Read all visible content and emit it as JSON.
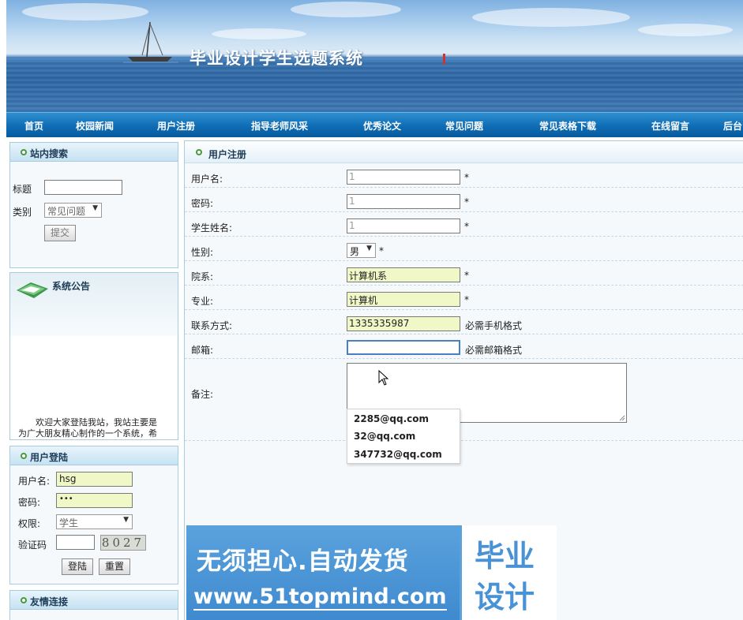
{
  "banner": {
    "title": "毕业设计学生选题系统"
  },
  "nav": {
    "items": [
      "首页",
      "校园新闻",
      "用户注册",
      "指导老师风采",
      "优秀论文",
      "常见问题",
      "常见表格下载",
      "在线留言",
      "后台"
    ]
  },
  "site_search": {
    "heading": "站内搜索",
    "title_label": "标题",
    "title_value": "",
    "category_label": "类别",
    "category_value": "常见问题",
    "submit_label": "提交"
  },
  "announcement": {
    "heading": "系统公告",
    "text_line1": "欢迎大家登陆我站，我站主要是",
    "text_line2": "为广大朋友精心制作的一个系统，希"
  },
  "login": {
    "heading": "用户登陆",
    "username_label": "用户名:",
    "username_value": "hsg",
    "password_label": "密码:",
    "password_value": "•••",
    "role_label": "权限:",
    "role_value": "学生",
    "captcha_label": "验证码",
    "captcha_value": "",
    "captcha_image_text": "8027",
    "login_button": "登陆",
    "reset_button": "重置"
  },
  "links": {
    "heading": "友情连接"
  },
  "register": {
    "heading": "用户注册",
    "fields": {
      "username": {
        "label": "用户名:",
        "value": "1",
        "suffix": "*"
      },
      "password": {
        "label": "密码:",
        "value": "1",
        "suffix": "*"
      },
      "student_name": {
        "label": "学生姓名:",
        "value": "1",
        "suffix": "*"
      },
      "gender": {
        "label": "性别:",
        "value": "男",
        "suffix": "*"
      },
      "department": {
        "label": "院系:",
        "value": "计算机系",
        "suffix": "*"
      },
      "major": {
        "label": "专业:",
        "value": "计算机",
        "suffix": "*"
      },
      "phone": {
        "label": "联系方式:",
        "value": "1335335987",
        "hint": "必需手机格式"
      },
      "email": {
        "label": "邮箱:",
        "value": "",
        "hint": "必需邮箱格式"
      },
      "remark": {
        "label": "备注:",
        "value": ""
      }
    },
    "email_suggestions": [
      "2285@qq.com",
      "32@qq.com",
      "347732@qq.com"
    ]
  },
  "ad": {
    "slogan": "无须担心.自动发货",
    "url": "www.51topmind.com",
    "logo_line1": "毕业",
    "logo_line2": "设计"
  },
  "colors": {
    "nav_bg": "#0f6db5",
    "input_highlight": "#f0f8c8",
    "panel_border": "#a9cbe0",
    "ad_bg": "#4a92d6"
  }
}
